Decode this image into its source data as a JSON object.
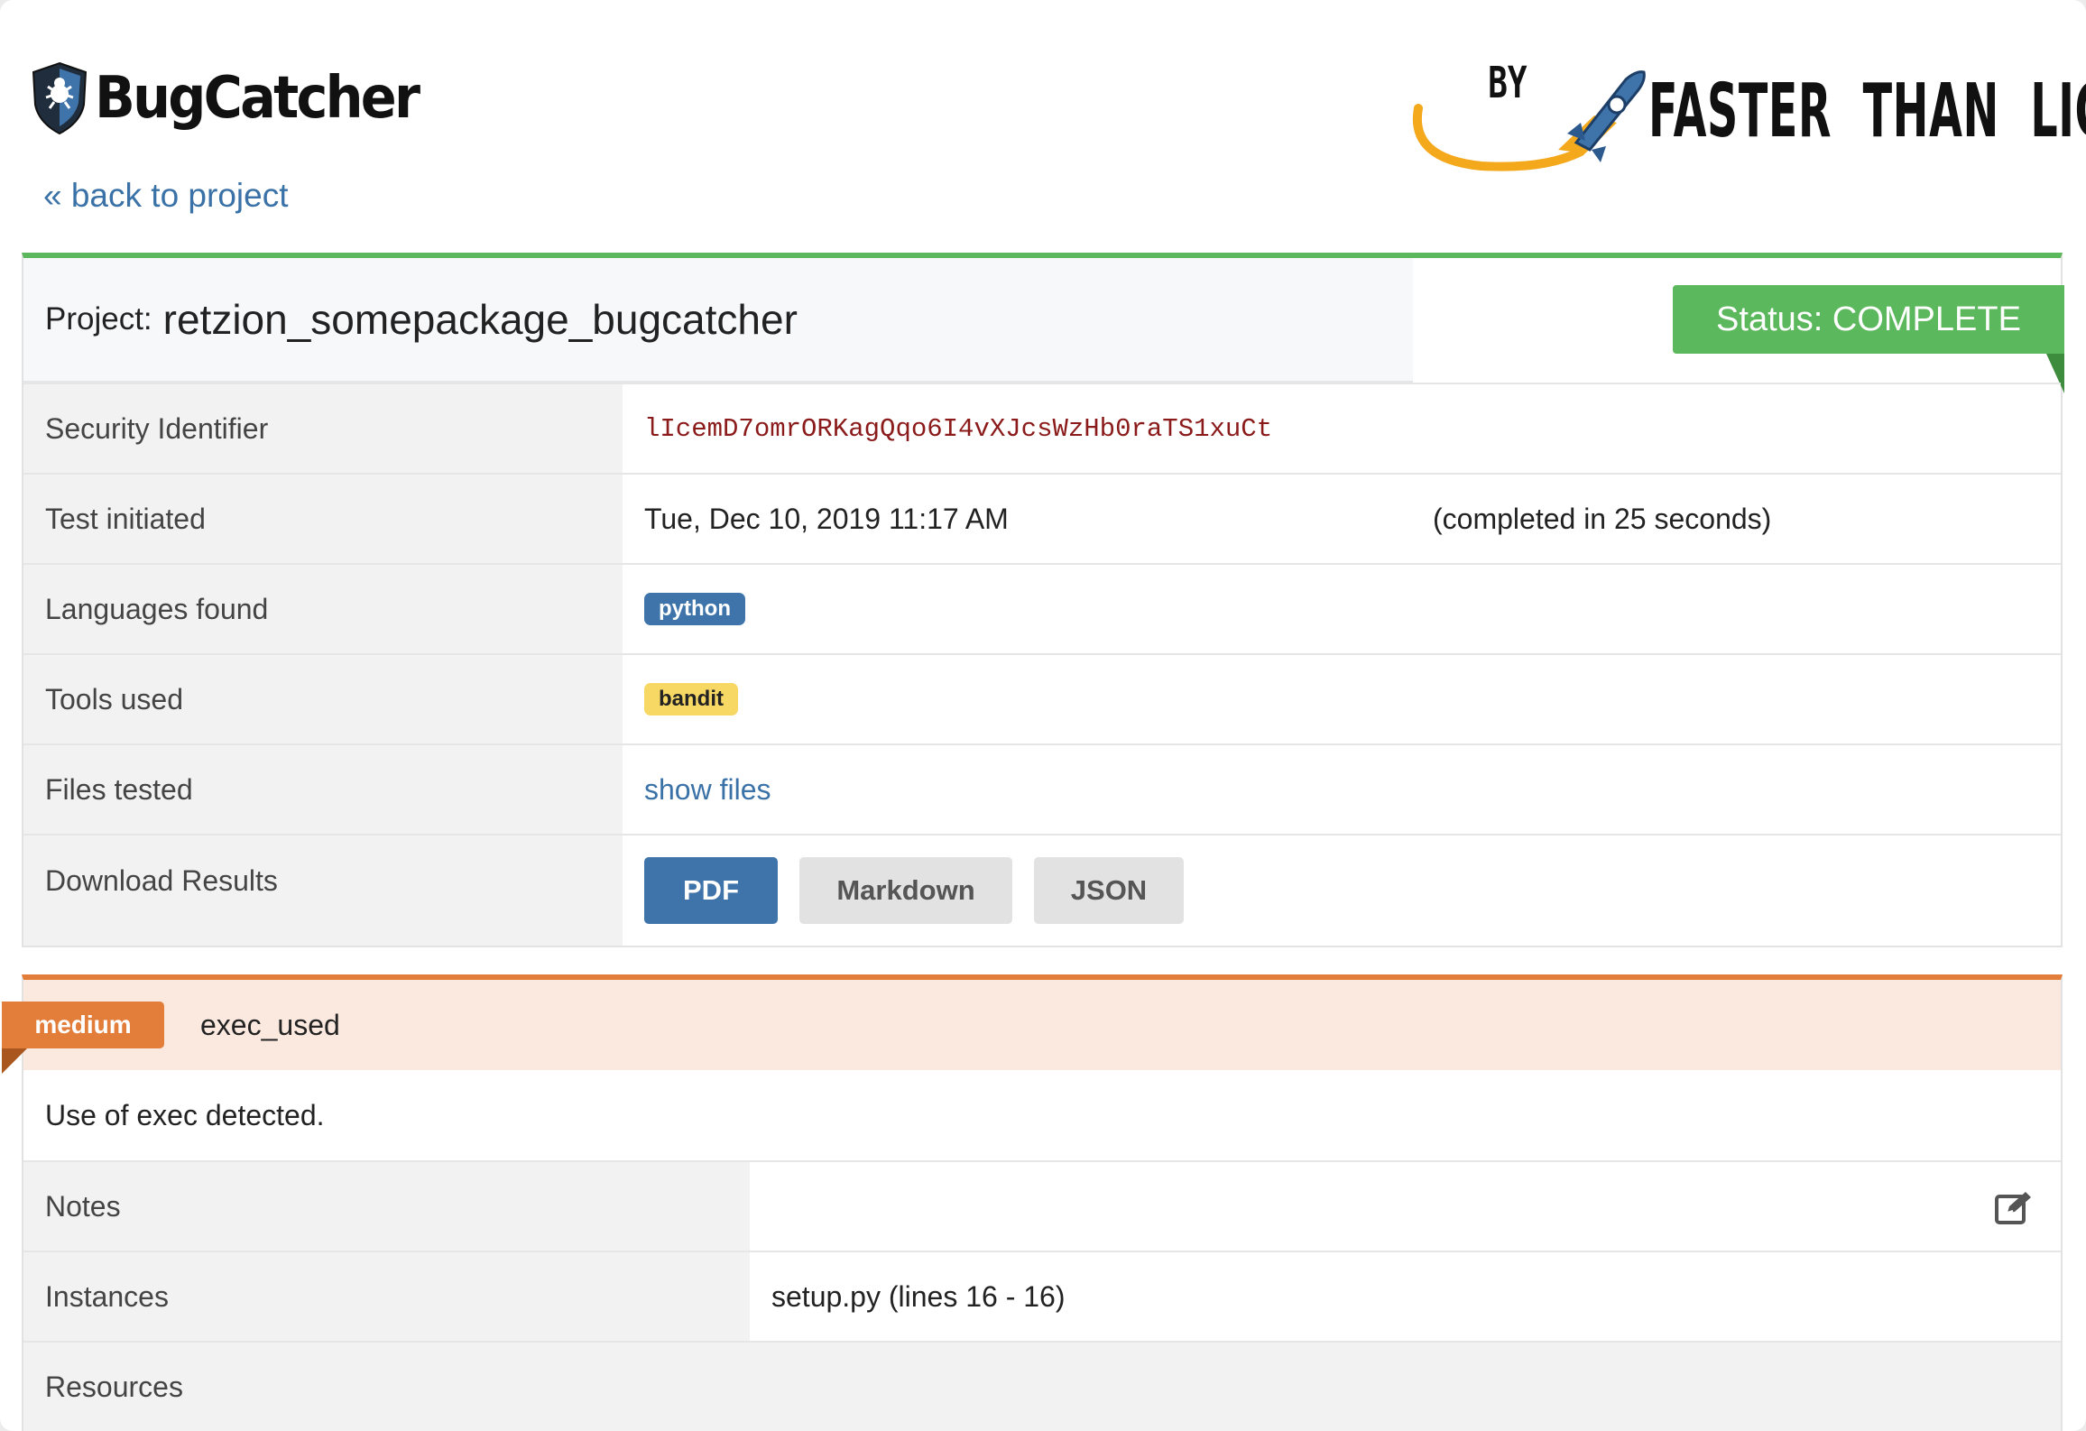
{
  "brand": {
    "name": "BugCatcher",
    "by": "BY",
    "partner": "FASTER THAN LIGHT"
  },
  "nav": {
    "back_label": "« back to project"
  },
  "project": {
    "label": "Project:",
    "name": "retzion_somepackage_bugcatcher",
    "status": "Status: COMPLETE",
    "rows": {
      "security_identifier": {
        "label": "Security Identifier",
        "value": "lIcemD7omrORKagQqo6I4vXJcsWzHb0raTS1xuCt"
      },
      "test_initiated": {
        "label": "Test initiated",
        "value": "Tue, Dec 10, 2019 11:17 AM",
        "completed": "(completed in 25 seconds)"
      },
      "languages": {
        "label": "Languages found",
        "badge": "python"
      },
      "tools": {
        "label": "Tools used",
        "badge": "bandit"
      },
      "files": {
        "label": "Files tested",
        "link": "show files"
      },
      "download": {
        "label": "Download Results",
        "pdf": "PDF",
        "markdown": "Markdown",
        "json": "JSON"
      }
    }
  },
  "issue": {
    "severity": "medium",
    "name": "exec_used",
    "description": "Use of exec detected.",
    "rows": {
      "notes": {
        "label": "Notes"
      },
      "instances": {
        "label": "Instances",
        "value": "setup.py (lines 16 - 16)"
      },
      "resources": {
        "label": "Resources"
      }
    }
  },
  "colors": {
    "status_green": "#5cb85c",
    "severity_orange": "#e27d3a",
    "link_blue": "#3a72a8",
    "badge_python": "#3f74aa",
    "badge_bandit": "#f7d864",
    "security_id": "#8b1a1a"
  }
}
